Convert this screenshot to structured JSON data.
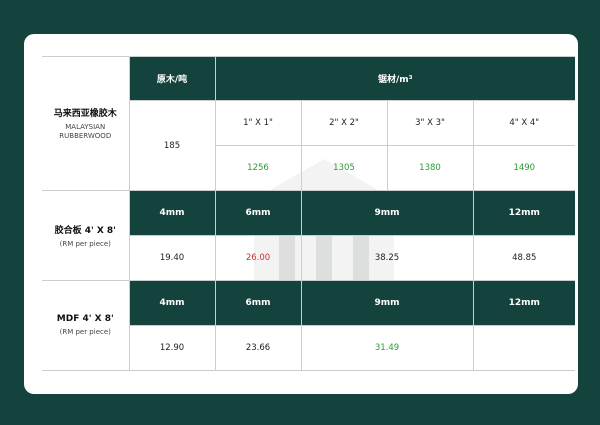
{
  "rubberwood": {
    "name_cn": "马来西亚橡胶木",
    "name_en_1": "MALAYSIAN",
    "name_en_2": "RUBBERWOOD",
    "log_header": "原木/吨",
    "log_value": "185",
    "sawn_header": "锯材/m³",
    "sizes": [
      "1\" X 1\"",
      "2\" X 2\"",
      "3\" X 3\"",
      "4\" X 4\""
    ],
    "prices": [
      "1256",
      "1305",
      "1380",
      "1490"
    ]
  },
  "plywood": {
    "name": "胶合板 4' X 8'",
    "unit": "(RM per piece)",
    "thicknesses": [
      "4mm",
      "6mm",
      "9mm",
      "12mm"
    ],
    "prices": [
      "19.40",
      "26.00",
      "38.25",
      "48.85"
    ]
  },
  "mdf": {
    "name": "MDF 4' X 8'",
    "unit": "(RM per piece)",
    "thicknesses": [
      "4mm",
      "6mm",
      "9mm",
      "12mm"
    ],
    "prices": [
      "12.90",
      "23.66",
      "31.49",
      ""
    ]
  },
  "colors": {
    "background": "#14423c",
    "header": "#14423c",
    "rise": "#2e9a35",
    "fall": "#d42c2c"
  }
}
